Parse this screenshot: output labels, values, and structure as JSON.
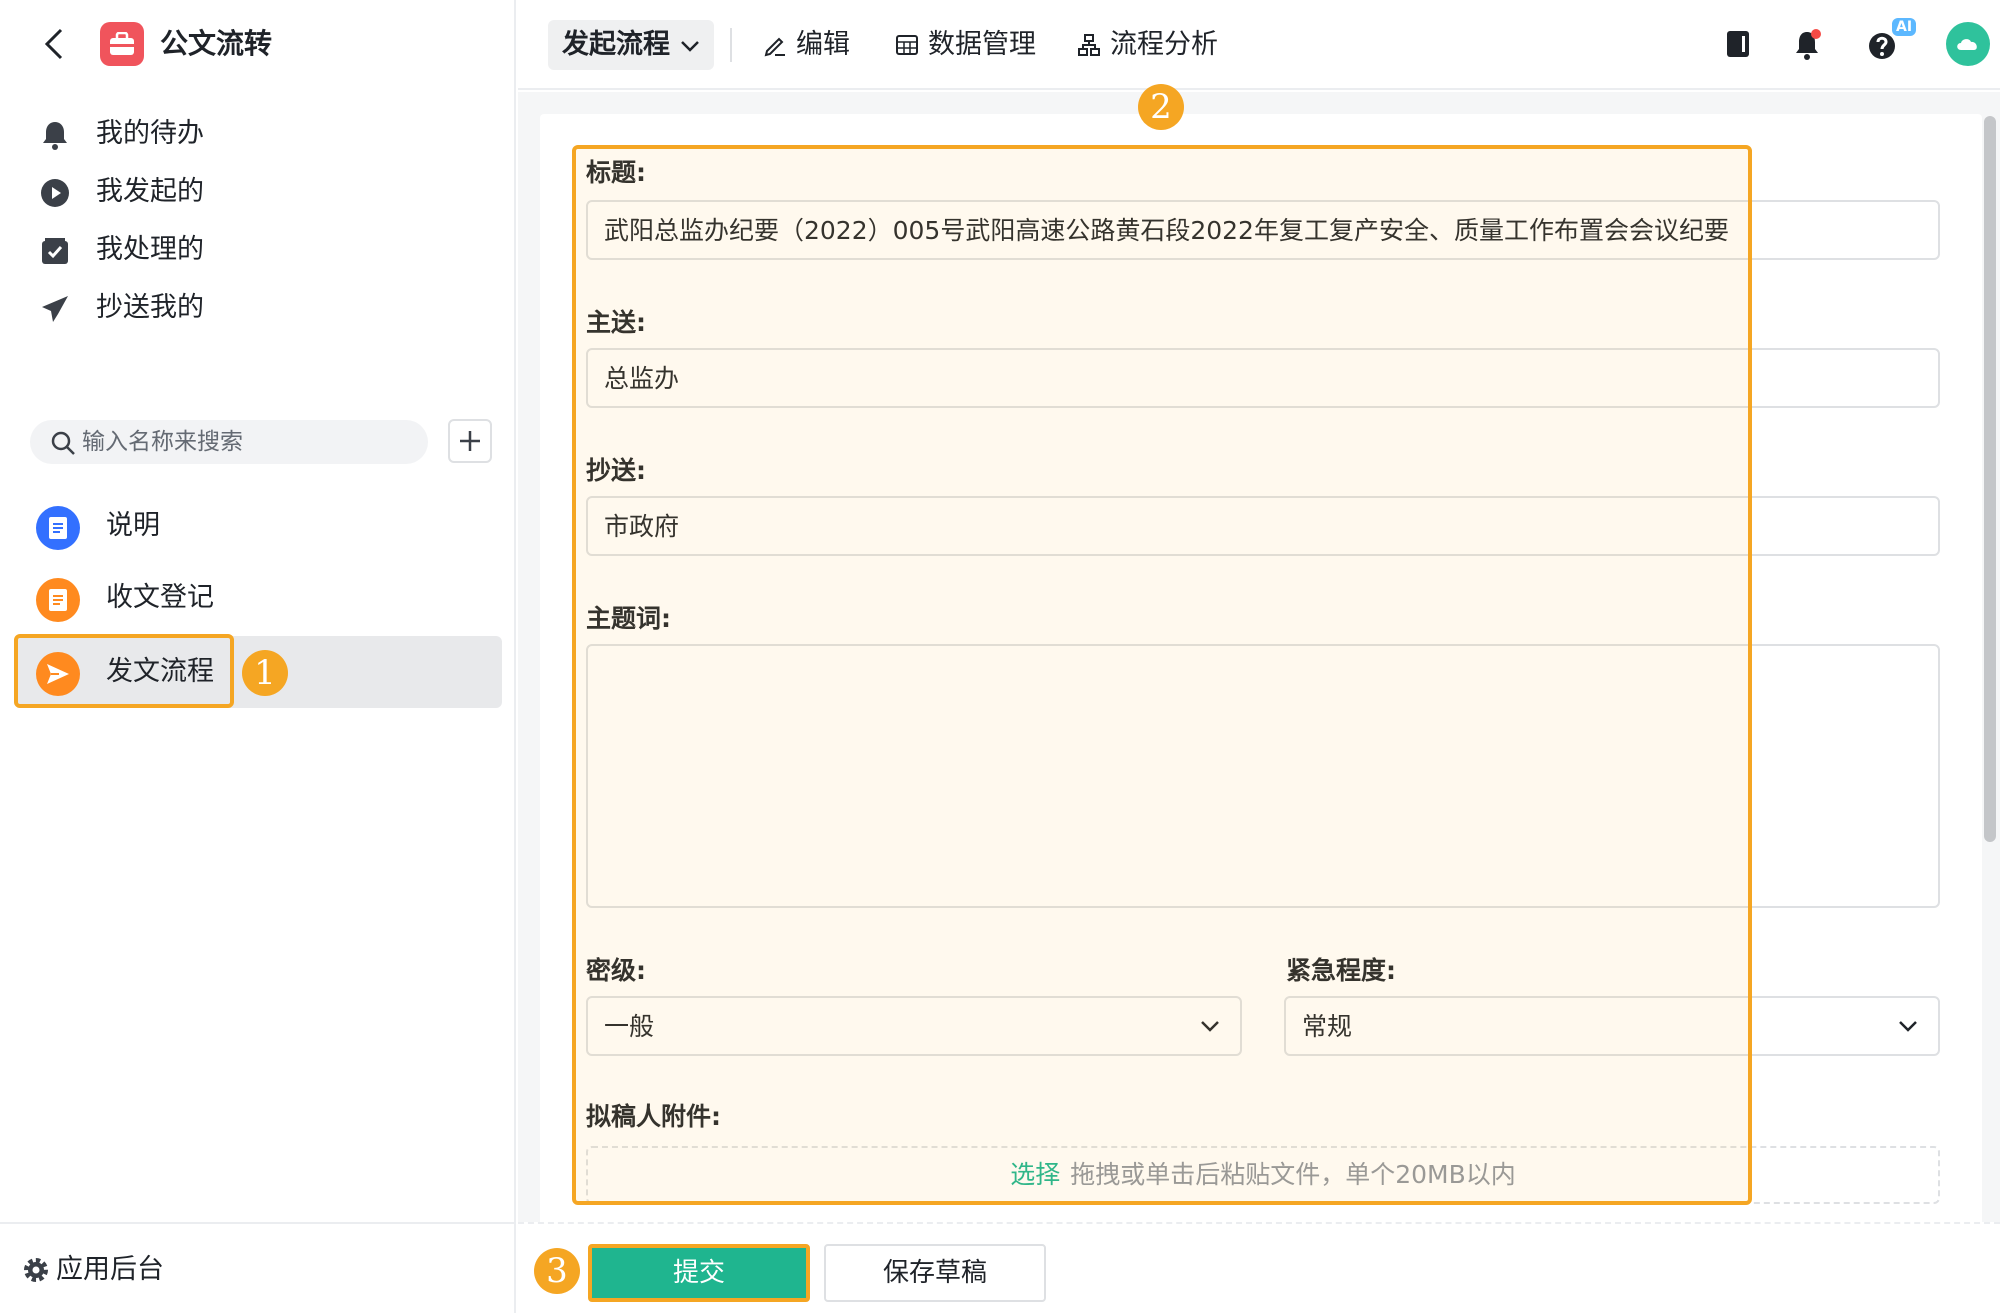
{
  "app": {
    "title": "公文流转",
    "logo_icon": "briefcase-icon",
    "logo_color": "#f0545c"
  },
  "sidebar": {
    "nav": [
      {
        "label": "我的待办",
        "icon": "bell-icon"
      },
      {
        "label": "我发起的",
        "icon": "play-circle-icon"
      },
      {
        "label": "我处理的",
        "icon": "check-box-icon"
      },
      {
        "label": "抄送我的",
        "icon": "paper-plane-icon"
      }
    ],
    "search": {
      "placeholder": "输入名称来搜索"
    },
    "forms": [
      {
        "label": "说明",
        "icon": "document-icon",
        "color": "#3370ff"
      },
      {
        "label": "收文登记",
        "icon": "document-icon",
        "color": "#ff8a1f"
      },
      {
        "label": "发文流程",
        "icon": "send-icon",
        "color": "#ff8a1f",
        "active": true
      }
    ],
    "footer_label": "应用后台"
  },
  "toolbar": {
    "start_flow": "发起流程",
    "edit": "编辑",
    "data_manage": "数据管理",
    "flow_analysis": "流程分析",
    "ai_badge": "AI"
  },
  "form": {
    "title_label": "标题:",
    "title_value": "武阳总监办纪要（2022）005号武阳高速公路黄石段2022年复工复产安全、质量工作布置会会议纪要",
    "main_to_label": "主送:",
    "main_to_value": "总监办",
    "cc_label": "抄送:",
    "cc_value": "市政府",
    "keywords_label": "主题词:",
    "keywords_value": "",
    "secrecy_label": "密级:",
    "secrecy_value": "一般",
    "urgency_label": "紧急程度:",
    "urgency_value": "常规",
    "attachment_label": "拟稿人附件:",
    "upload_select": "选择",
    "upload_hint": "拖拽或单击后粘贴文件，单个20MB以内"
  },
  "actions": {
    "submit": "提交",
    "save_draft": "保存草稿"
  },
  "callouts": {
    "one": "1",
    "two": "2",
    "three": "3"
  },
  "colors": {
    "accent": "#1fb58f",
    "highlight": "#f5a623"
  }
}
